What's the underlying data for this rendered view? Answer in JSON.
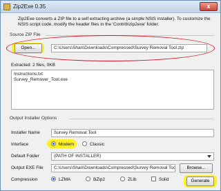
{
  "window": {
    "title": "Zip2Exe 0.35",
    "close_symbol": "x"
  },
  "description": "Zip2Exe converts a ZIP file to a self extracting archive (a simple NSIS installer). To customize the NSIS script code, modify the header files in the 'Contrib\\zip2exe' folder.",
  "source": {
    "group_label": "Source ZIP File",
    "open_label": "Open...",
    "path": "C:\\Users\\Shan\\Downloads\\Compressed\\Survey Removal Tool.zip",
    "extracted": "Extracted: 2 files, 0KB",
    "files": [
      "Instructions.txt",
      "Survey_Remover_Tool.exe"
    ]
  },
  "output": {
    "group_label": "Output Installer Options",
    "installer_name_label": "Installer Name",
    "installer_name": "Survey Removal Tool",
    "interface_label": "Interface",
    "interface_options": [
      "Modern",
      "Classic"
    ],
    "interface_selected": "Modern",
    "default_folder_label": "Default Folder",
    "default_folder": "(PATH OF INSTALLER)",
    "output_exe_label": "Output EXE File",
    "output_exe": "C:\\Users\\Shan\\Downloads\\Compressed\\Survey Removal Tool.",
    "browse_label": "Browse...",
    "compression_label": "Compression",
    "compression_options": [
      "LZMA",
      "BZip2",
      "ZLib"
    ],
    "compression_selected": "LZMA",
    "solid_label": "Solid"
  },
  "actions": {
    "generate_label": "Generate"
  },
  "colors": {
    "highlight_yellow": "#fff000",
    "highlight_red": "#d1161d"
  }
}
